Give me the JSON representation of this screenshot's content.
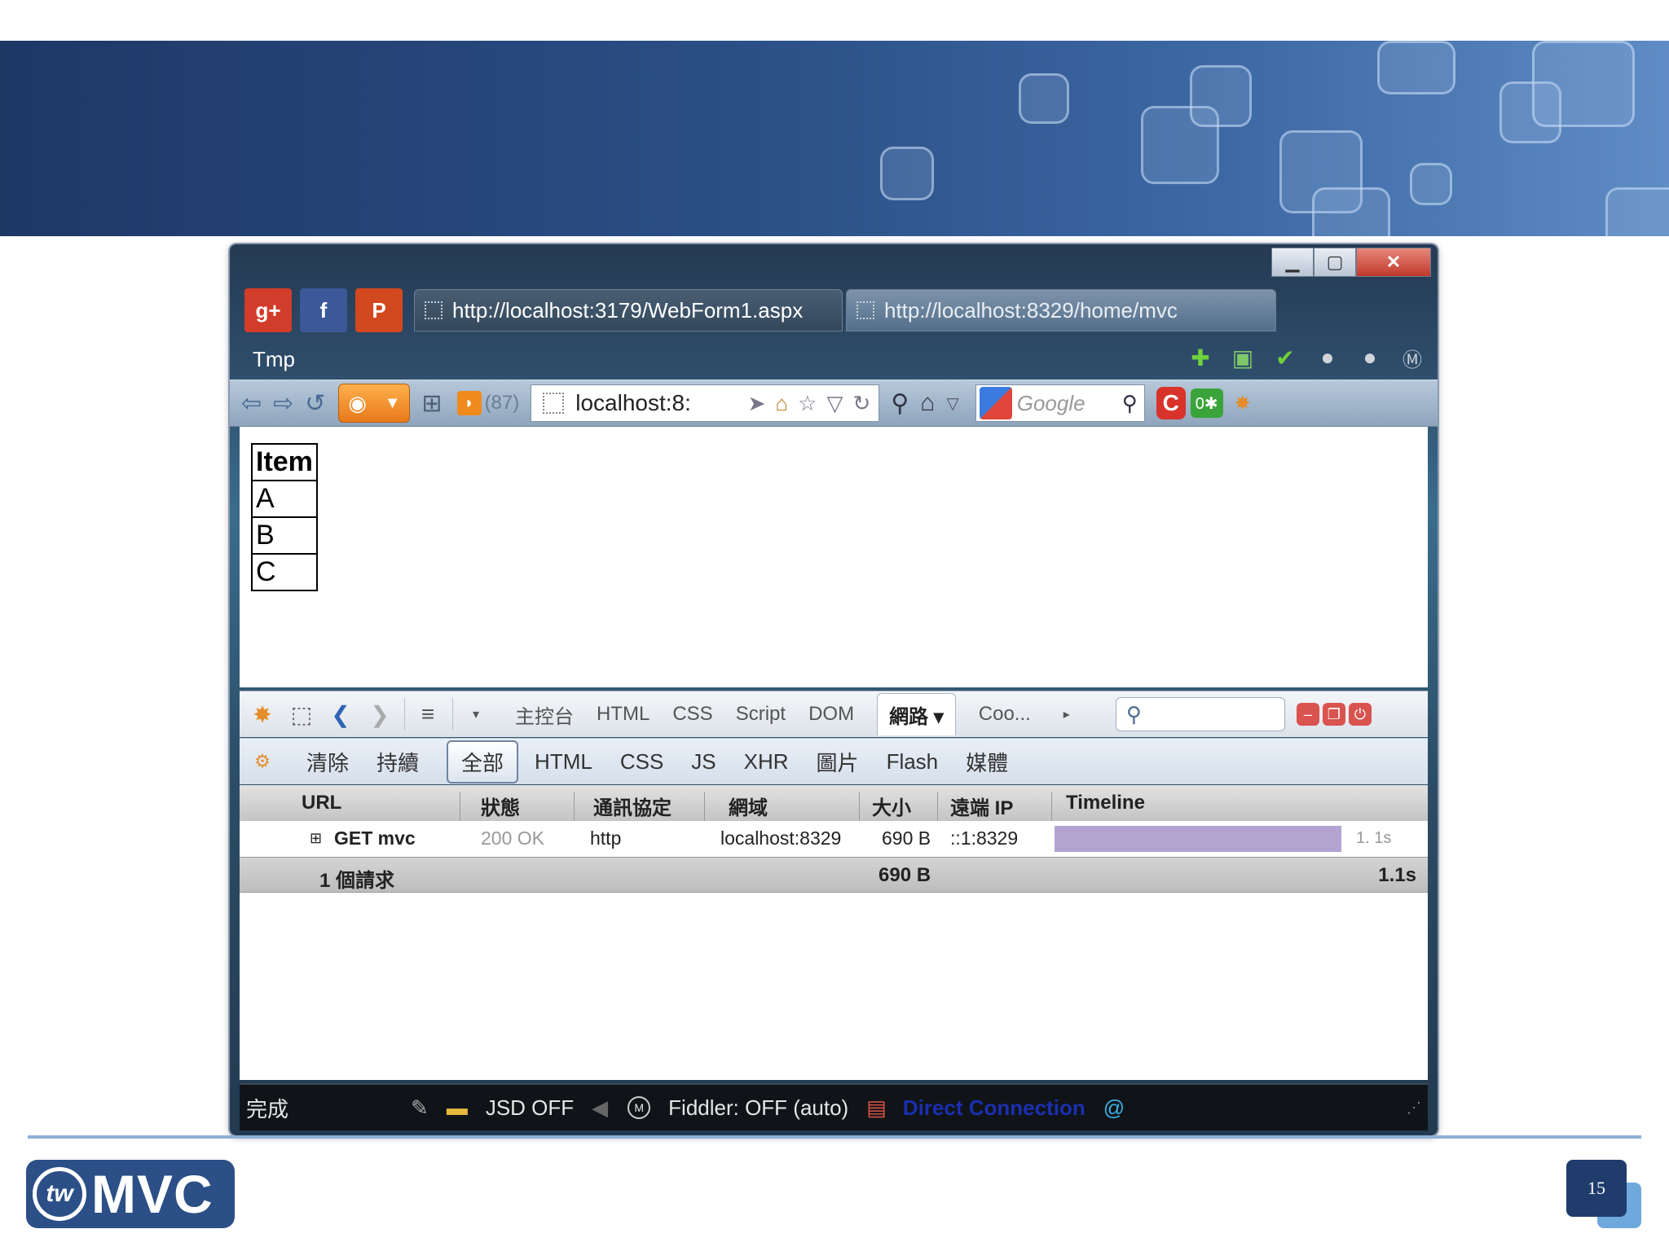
{
  "slide": {
    "logo_badge": "tw",
    "logo_text": "MVC",
    "page_number": "15"
  },
  "window": {
    "controls": {
      "minimize": "▁",
      "maximize": "▢",
      "close": "✕"
    },
    "social_buttons": [
      "g+",
      "f",
      "P"
    ],
    "tabs": [
      {
        "label": "http://localhost:3179/WebForm1.aspx",
        "active": false
      },
      {
        "label": "http://localhost:8329/home/mvc",
        "active": true
      }
    ],
    "menu": {
      "tmp_label": "Tmp"
    },
    "nav": {
      "rss_count": "(87)",
      "url_text": "localhost:8:",
      "search_placeholder": "Google"
    }
  },
  "page_content": {
    "table": {
      "header": "Item",
      "rows": [
        "A",
        "B",
        "C"
      ]
    }
  },
  "firebug": {
    "panel_tabs": [
      "主控台",
      "HTML",
      "CSS",
      "Script",
      "DOM",
      "網路 ▾",
      "Coo..."
    ],
    "active_panel": "網路 ▾",
    "net_toolbar": {
      "actions": [
        "清除",
        "持續"
      ],
      "filters": [
        "全部",
        "HTML",
        "CSS",
        "JS",
        "XHR",
        "圖片",
        "Flash",
        "媒體"
      ],
      "active_filter": "全部"
    },
    "columns": [
      "URL",
      "狀態",
      "通訊協定",
      "網域",
      "大小",
      "遠端 IP",
      "Timeline"
    ],
    "requests": [
      {
        "url": "GET mvc",
        "status": "200 OK",
        "protocol": "http",
        "domain": "localhost:8329",
        "size": "690 B",
        "remote_ip": "::1:8329",
        "timeline_label": "1. 1s"
      }
    ],
    "summary": {
      "count": "1 個請求",
      "size": "690 B",
      "time": "1.1s"
    }
  },
  "statusbar": {
    "done": "完成",
    "jsd": "JSD OFF",
    "fiddler": "Fiddler: OFF (auto)",
    "connection": "Direct Connection"
  }
}
